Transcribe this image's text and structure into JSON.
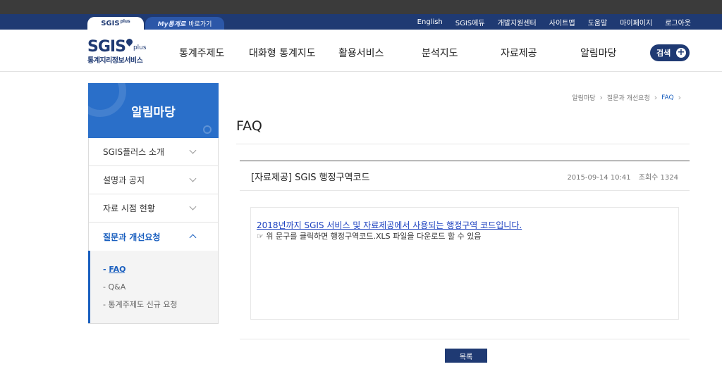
{
  "top_tabs": {
    "sgis": "SGIS",
    "sgis_plus": "plus",
    "my_logo": "My통계로",
    "my_label": "바로가기"
  },
  "util_nav": [
    "English",
    "SGIS에듀",
    "개발지원센터",
    "사이트맵",
    "도움말",
    "마이페이지",
    "로그아웃"
  ],
  "logo": {
    "main": "SGIS",
    "plus": "plus",
    "sub": "통계지리정보서비스"
  },
  "gnb": [
    "통계주제도",
    "대화형 통계지도",
    "활용서비스",
    "분석지도",
    "자료제공",
    "알림마당"
  ],
  "search_label": "검색",
  "lnb": {
    "title": "알림마당",
    "items": [
      "SGIS플러스 소개",
      "설명과 공지",
      "자료 시점 현황",
      "질문과 개선요청"
    ],
    "sub_items": [
      "FAQ",
      "Q&A",
      "통계주제도 신규 요청"
    ]
  },
  "breadcrumb": [
    "알림마당",
    "질문과 개선요청",
    "FAQ"
  ],
  "page_title": "FAQ",
  "post": {
    "title": "[자료제공] SGIS 행정구역코드",
    "date": "2015-09-14 10:41",
    "views_label": "조회수",
    "views": "1324",
    "link_text": "2018년까지 SGIS 서비스 및 자료제공에서 사용되는 행정구역 코드입니다.",
    "description": "☞ 위 문구를 클릭하면 행정구역코드.XLS 파일을 다운로드 할 수 있음"
  },
  "list_button": "목록"
}
